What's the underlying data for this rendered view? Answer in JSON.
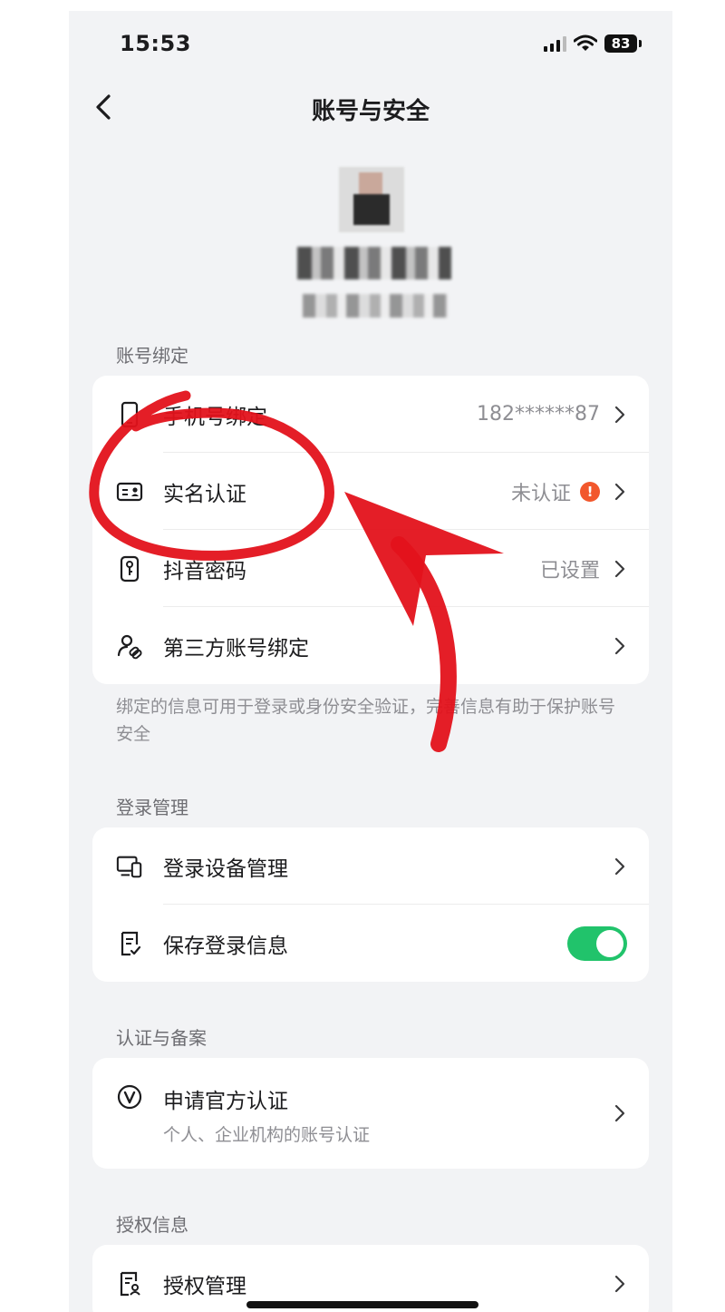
{
  "status_bar": {
    "time": "15:53",
    "battery": "83"
  },
  "nav": {
    "title": "账号与安全"
  },
  "sections": {
    "binding": {
      "title": "账号绑定",
      "rows": [
        {
          "label": "手机号绑定",
          "value": "182******87",
          "icon": "phone-icon"
        },
        {
          "label": "实名认证",
          "value": "未认证",
          "icon": "id-card-icon",
          "badge": "!"
        },
        {
          "label": "抖音密码",
          "value": "已设置",
          "icon": "key-icon"
        },
        {
          "label": "第三方账号绑定",
          "value": "",
          "icon": "linked-account-icon"
        }
      ],
      "note": "绑定的信息可用于登录或身份安全验证，完善信息有助于保护账号安全"
    },
    "login": {
      "title": "登录管理",
      "rows": [
        {
          "label": "登录设备管理",
          "icon": "devices-icon"
        },
        {
          "label": "保存登录信息",
          "icon": "document-check-icon",
          "toggle_on": true
        }
      ]
    },
    "certification": {
      "title": "认证与备案",
      "rows": [
        {
          "label": "申请官方认证",
          "subtitle": "个人、企业机构的账号认证",
          "icon": "verified-v-icon"
        }
      ]
    },
    "authorization": {
      "title": "授权信息",
      "rows": [
        {
          "label": "授权管理",
          "icon": "authorization-doc-icon"
        }
      ]
    }
  },
  "colors": {
    "toggle_on": "#21c36b",
    "warning": "#f2572c",
    "annotation": "#e3121b"
  }
}
